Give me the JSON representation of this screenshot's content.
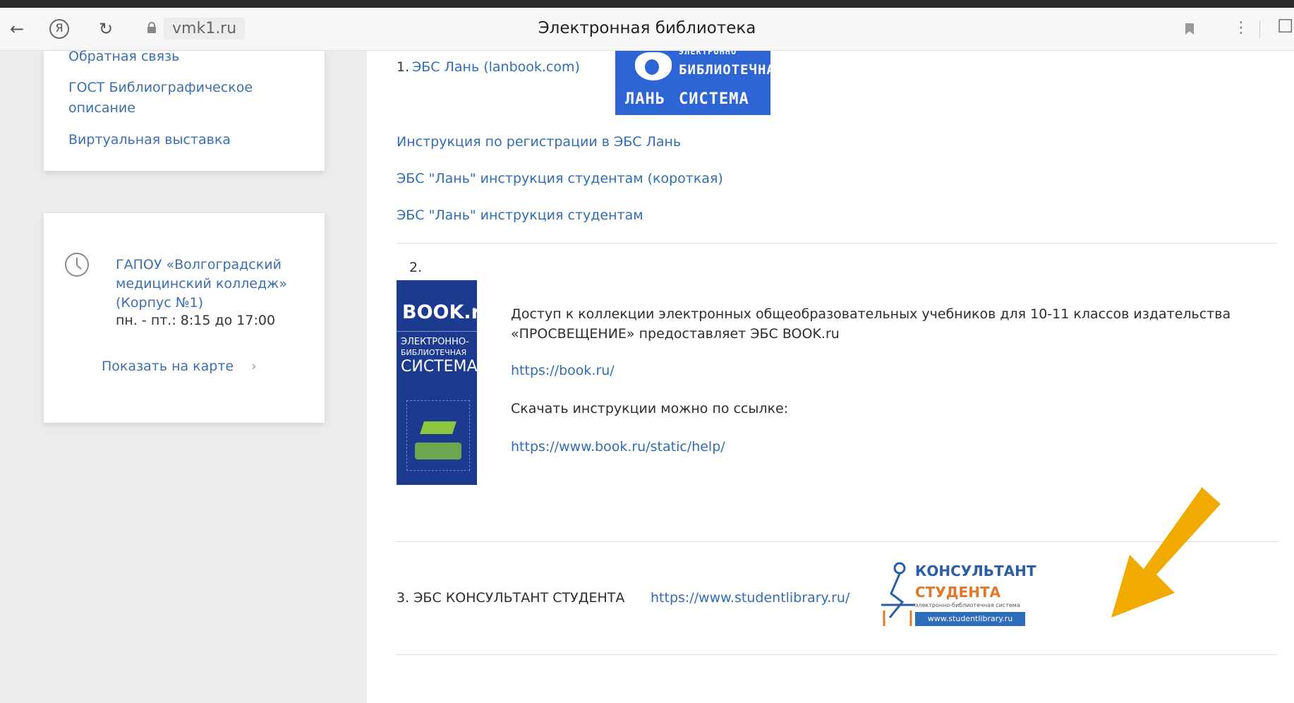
{
  "browser": {
    "back_icon": "←",
    "yandex_icon": "Я",
    "reload_icon": "↻",
    "url": "vmk1.ru",
    "title": "Электронная библиотека",
    "menu_icon": "⋮"
  },
  "sidebar": {
    "links": [
      "Обратная связь",
      "ГОСТ Библиографическое описание",
      "Виртуальная выставка"
    ],
    "contact": {
      "org": "ГАПОУ «Волгоградский медицинский колледж» (Корпус №1)",
      "hours": "пн. - пт.: 8:15 до 17:00",
      "map_link": "Показать на карте",
      "chevron": "›"
    }
  },
  "main": {
    "item1": {
      "num": "1.",
      "label": "ЭБС Лань (lanbook.com)",
      "logo_text_top": "ЭЛЕКТРОННО",
      "logo_text_mid": "БИБЛИОТЕЧНАЯ",
      "logo_text_left": "ЛАНЬ",
      "logo_text_right": "СИСТЕМА",
      "links": [
        "Инструкция по регистрации в ЭБС Лань",
        "ЭБС \"Лань\" инструкция студентам (короткая)",
        "ЭБС \"Лань\" инструкция студентам"
      ]
    },
    "item2": {
      "num": "2.",
      "logo_title": "BOOK.ru",
      "logo_line1": "ЭЛЕКТРОННО-",
      "logo_line2": "БИБЛИОТЕЧНАЯ",
      "logo_line3": "СИСТЕМА",
      "desc_line1": "Доступ к коллекции электронных общеобразовательных учебников для 10-11 классов издательства",
      "desc_line2": "«ПРОСВЕЩЕНИЕ» предоставляет ЭБС BOOK.ru",
      "link1": "https://book.ru/",
      "instructions_text": "Скачать инструкции можно по ссылке:",
      "link2": "https://www.book.ru/static/help/"
    },
    "item3": {
      "label": "3. ЭБС КОНСУЛЬТАНТ СТУДЕНТА",
      "link": "https://www.studentlibrary.ru/",
      "logo_title1": "КОНСУЛЬТАНТ",
      "logo_title2": "СТУДЕНТА",
      "logo_sub": "электронно-библиотечная система",
      "logo_url": "www.studentlibrary.ru"
    }
  },
  "annotation": {
    "arrow_color": "#f0aa00"
  }
}
